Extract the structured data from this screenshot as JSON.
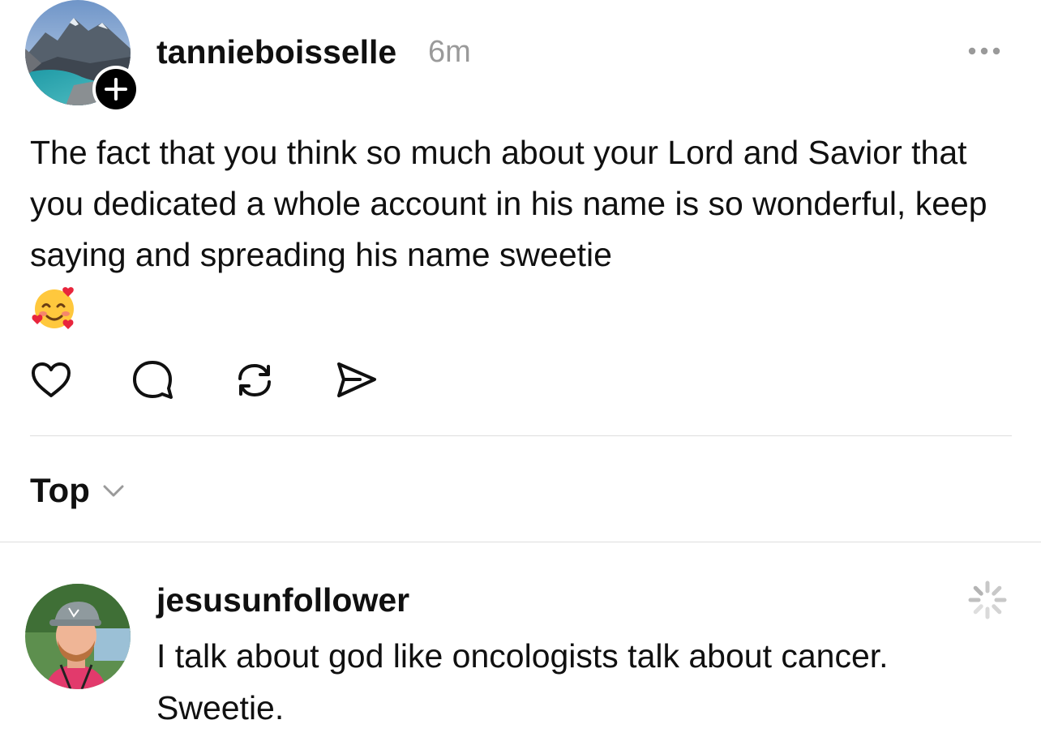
{
  "post": {
    "username": "tannieboisselle",
    "timestamp": "6m",
    "text": "The fact that you think so much about your Lord and Savior that you dedicated a whole account in his name is so wonderful, keep saying and spreading his name sweetie",
    "emoji_icon": "smiling-face-with-hearts-icon",
    "actions": [
      "heart-icon",
      "comment-icon",
      "repost-icon",
      "send-icon"
    ]
  },
  "sort": {
    "label": "Top",
    "icon": "chevron-down-icon"
  },
  "reply": {
    "username": "jesusunfollower",
    "text": "I talk about god like oncologists talk about cancer. Sweetie.",
    "status_icon": "loading-spinner-icon"
  },
  "colors": {
    "text": "#101010",
    "muted": "#9a9a9a",
    "divider": "#dedede",
    "background": "#ffffff"
  }
}
